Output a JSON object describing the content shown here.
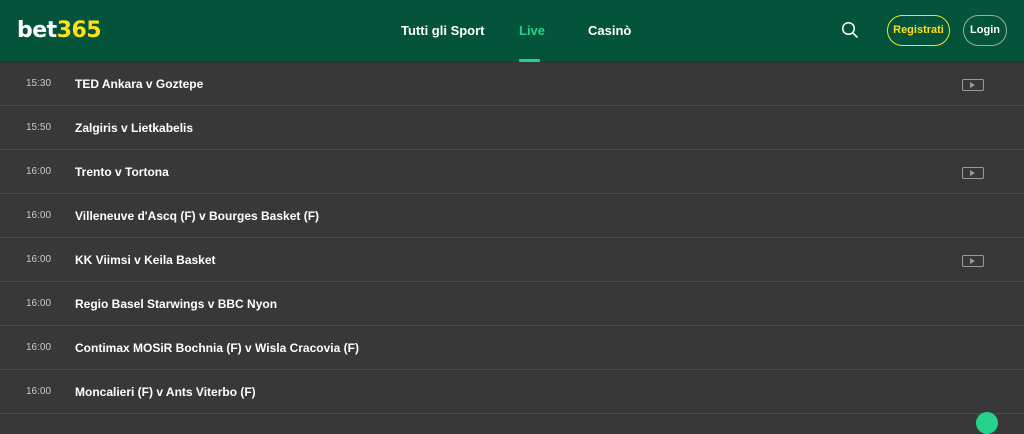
{
  "brand": {
    "part1": "bet",
    "part2": "365"
  },
  "nav": {
    "sports_label": "Tutti gli Sport",
    "live_label": "Live",
    "casino_label": "Casinò"
  },
  "header": {
    "search_icon": "search-icon",
    "register_label": "Registrati",
    "login_label": "Login"
  },
  "colors": {
    "header_bg": "#03543a",
    "accent_green": "#26d38c",
    "brand_yellow": "#ffdf1b",
    "list_bg": "#383838"
  },
  "matches": [
    {
      "time": "15:30",
      "teams": "TED Ankara v Goztepe",
      "video": true
    },
    {
      "time": "15:50",
      "teams": "Zalgiris v Lietkabelis",
      "video": false
    },
    {
      "time": "16:00",
      "teams": "Trento v Tortona",
      "video": true
    },
    {
      "time": "16:00",
      "teams": "Villeneuve d'Ascq (F) v Bourges Basket (F)",
      "video": false
    },
    {
      "time": "16:00",
      "teams": "KK Viimsi v Keila Basket",
      "video": true
    },
    {
      "time": "16:00",
      "teams": "Regio Basel Starwings v BBC Nyon",
      "video": false
    },
    {
      "time": "16:00",
      "teams": "Contimax MOSiR Bochnia (F) v Wisla Cracovia (F)",
      "video": false
    },
    {
      "time": "16:00",
      "teams": "Moncalieri (F) v Ants Viterbo (F)",
      "video": false
    }
  ]
}
